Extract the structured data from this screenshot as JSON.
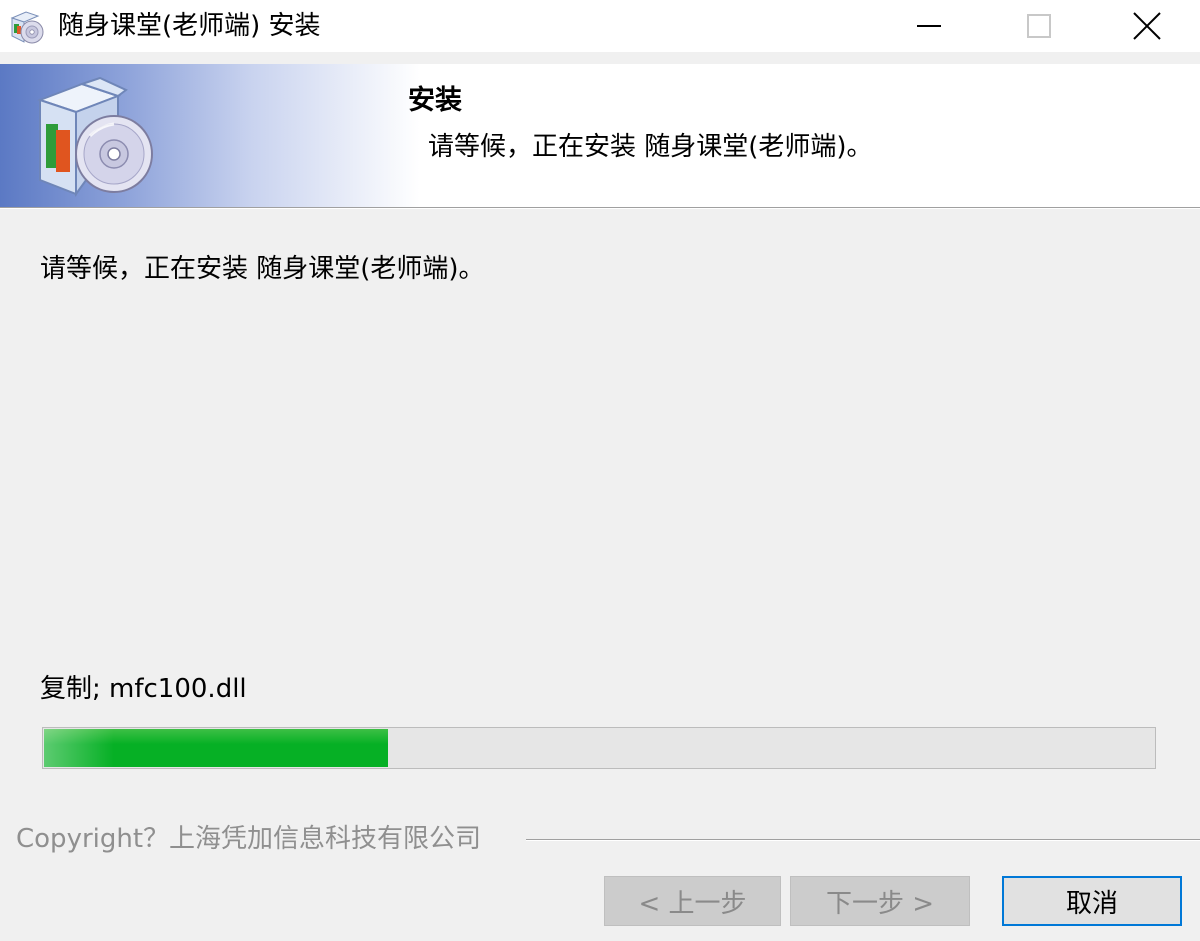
{
  "window": {
    "title": "随身课堂(老师端) 安装",
    "controls": {
      "minimize": "minimize-icon",
      "maximize": "maximize-icon",
      "close": "close-icon"
    }
  },
  "header": {
    "title": "安装",
    "subtitle": "请等候，正在安装 随身课堂(老师端)。",
    "graphic": "installer-box-disc-icon"
  },
  "main": {
    "status_text": "请等候，正在安装 随身课堂(老师端)。",
    "current_file": "复制; mfc100.dll",
    "progress_fraction": 0.31
  },
  "footer": {
    "copyright": "Copyright？上海凭加信息科技有限公司",
    "buttons": {
      "back": "< 上一步",
      "next": "下一步 >",
      "cancel": "取消"
    }
  },
  "colors": {
    "progress_fill": "#06b025",
    "accent_focus": "#0078d7",
    "header_gradient_start": "#5b79c4"
  }
}
